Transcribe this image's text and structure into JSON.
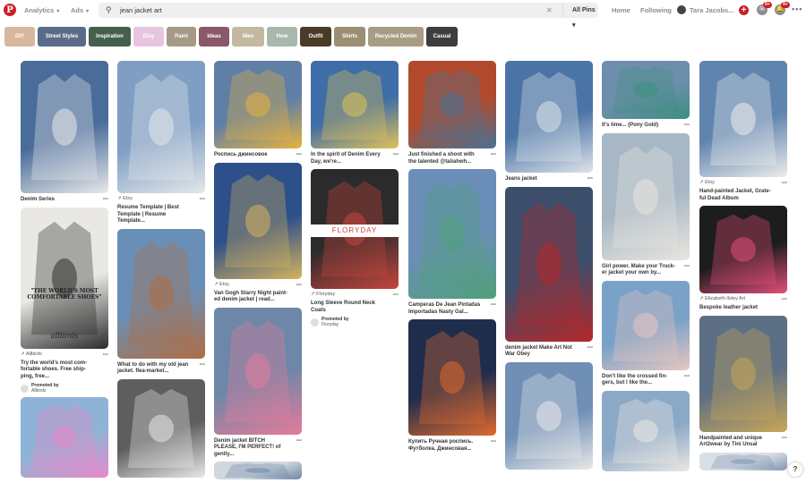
{
  "nav": {
    "logo": "P",
    "analytics": "Analytics",
    "ads": "Ads",
    "search_value": "jean jacket art",
    "scope": "All Pins",
    "home": "Home",
    "following": "Following",
    "user": "Tara Jacobs...",
    "badge_messages": "9+",
    "badge_notifications": "9+",
    "help": "?"
  },
  "guides": [
    {
      "label": "DIY",
      "color": "#d8b89d"
    },
    {
      "label": "Street Styles",
      "color": "#5b6c8a"
    },
    {
      "label": "Inspiration",
      "color": "#44604c"
    },
    {
      "label": "Etsy",
      "color": "#e7c5e1"
    },
    {
      "label": "Paint",
      "color": "#a79a85"
    },
    {
      "label": "Ideas",
      "color": "#8c5868"
    },
    {
      "label": "Men",
      "color": "#c5b8a0"
    },
    {
      "label": "How",
      "color": "#a8b8ad"
    },
    {
      "label": "Outfit",
      "color": "#4a3a28"
    },
    {
      "label": "Shirts",
      "color": "#9c8e72"
    },
    {
      "label": "Recycled Denim",
      "color": "#a99c84"
    },
    {
      "label": "Casual",
      "color": "#3e3e3e"
    }
  ],
  "columns": [
    [
      {
        "caption": "Denim Series",
        "bg": "#4a6c9a",
        "accent": "#e9e9ea"
      },
      {
        "caption": "Try the world's most com-fortable shoes. Free ship-ping, free...",
        "bg": "#e9e8e4",
        "accent": "#2c2c2c",
        "overlay": "\"THE WORLD'S MOST COMFORTABLE SHOES\"",
        "brand": "allbirds",
        "source": "Allbirds",
        "promoted_by": "Promoted by",
        "promoter": "Allbirds"
      },
      {
        "caption": "",
        "bg": "#8fb3d6",
        "accent": "#e889c9"
      }
    ],
    [
      {
        "caption": "Resume Template | Best Template | Resume Template...",
        "bg": "#7e9ec4",
        "accent": "#e4e7ea",
        "source": "Etsy"
      },
      {
        "caption": "What to do with my old jean jacket. flea-market...",
        "bg": "#6a8fb6",
        "accent": "#b06d42"
      },
      {
        "caption": "",
        "bg": "#5e5e5e",
        "accent": "#e8e8e8"
      }
    ],
    [
      {
        "caption": "Роспись джинсовок",
        "bg": "#5f7fa6",
        "accent": "#e7b23e"
      },
      {
        "caption": "Van Gogh Starry Night paint-ed denim jacket | read...",
        "bg": "#2d4f8a",
        "accent": "#d5b35c",
        "source": "Etsy"
      },
      {
        "caption": "Denim jacket BITCH PLEASE, I'M PERFECT! of gently...",
        "bg": "#6c87a8",
        "accent": "#e57b9a"
      },
      {
        "caption": "",
        "bg": "#cfd7df",
        "accent": "#6d86a5"
      }
    ],
    [
      {
        "caption": "In the spirit of Denim Every Day, we're...",
        "bg": "#3f6da7",
        "accent": "#e0c257"
      },
      {
        "caption": "Long Sleeve Round Neck Coats",
        "bg": "#2b2b2b",
        "accent": "#c6453e",
        "brand": "FLORYDAY",
        "source": "Floryday",
        "promoted_by": "Promoted by",
        "promoter": "Floryday"
      }
    ],
    [
      {
        "caption": "Just finished a shoot with the talented @taliahwh...",
        "bg": "#b14a2c",
        "accent": "#487295"
      },
      {
        "caption": "Camperas De Jean Pintadas Importadas Nasty Gal...",
        "bg": "#6b8eb8",
        "accent": "#4fa079"
      },
      {
        "caption": "Купить Ручная роспись. Футболка. Джинсовая...",
        "bg": "#1f2d4d",
        "accent": "#e06a2e"
      }
    ],
    [
      {
        "caption": "Jeans jacket",
        "bg": "#4b74a6",
        "accent": "#dfe4ea"
      },
      {
        "caption": "denim jacket Make Art Not War Obey",
        "bg": "#3c4e6a",
        "accent": "#b5272a"
      },
      {
        "caption": "",
        "bg": "#6f8fb5",
        "accent": "#e9e9e9"
      }
    ],
    [
      {
        "caption": "It's time... (Pony Gold)",
        "bg": "#6d8eac",
        "accent": "#3b8f7e"
      },
      {
        "caption": "Girl power. Make your Truck-er jacket your own by...",
        "bg": "#a7b7c5",
        "accent": "#e9e6df"
      },
      {
        "caption": "Don't like the crossed fin-gers, but I like the...",
        "bg": "#7aa2c8",
        "accent": "#e8c7c0"
      },
      {
        "caption": "",
        "bg": "#8aa9c7",
        "accent": "#ede8e3"
      }
    ],
    [
      {
        "caption": "Hand-painted Jacket, Grate-ful Dead Album",
        "bg": "#5f84ae",
        "accent": "#ececec",
        "source": "Etsy"
      },
      {
        "caption": "Bespoke leather jacket",
        "bg": "#1d1d1d",
        "accent": "#e44e7a",
        "source": "Elizabeth Ilsley Art"
      },
      {
        "caption": "Handpainted and unique Art2wear by Tini Unsal",
        "bg": "#5d6f84",
        "accent": "#c8a657"
      },
      {
        "caption": "",
        "bg": "#d9dfe6",
        "accent": "#7f96b0"
      }
    ]
  ]
}
